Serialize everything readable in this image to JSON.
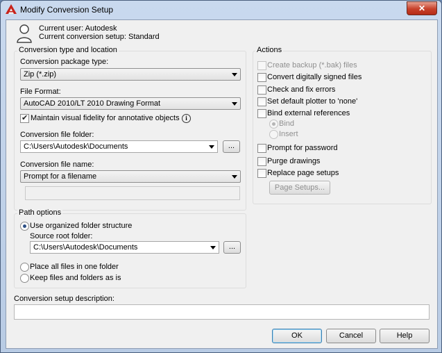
{
  "window": {
    "title": "Modify Conversion Setup",
    "close_glyph": "✕"
  },
  "header": {
    "current_user": "Current user: Autodesk",
    "current_setup": "Current conversion setup: Standard"
  },
  "conversion": {
    "group_title": "Conversion type and location",
    "package_label": "Conversion package type:",
    "package_value": "Zip (*.zip)",
    "format_label": "File Format:",
    "format_value": "AutoCAD 2010/LT 2010 Drawing Format",
    "fidelity_label": "Maintain visual fidelity for annotative objects",
    "fidelity_checked": true,
    "info_glyph": "i",
    "folder_label": "Conversion file folder:",
    "folder_value": "C:\\Users\\Autodesk\\Documents",
    "browse_label": "...",
    "name_label": "Conversion file name:",
    "name_value": "Prompt for a filename",
    "name_text": ""
  },
  "path": {
    "group_title": "Path options",
    "organized_label": "Use organized folder structure",
    "source_root_label": "Source root folder:",
    "source_root_value": "C:\\Users\\Autodesk\\Documents",
    "browse_label": "...",
    "one_folder_label": "Place all files in one folder",
    "keep_label": "Keep files and folders as is",
    "selected": "organized"
  },
  "actions": {
    "group_title": "Actions",
    "items": [
      {
        "label": "Create backup (*.bak) files",
        "checked": false,
        "enabled": false
      },
      {
        "label": "Convert digitally signed files",
        "checked": false,
        "enabled": true
      },
      {
        "label": "Check and fix errors",
        "checked": false,
        "enabled": true
      },
      {
        "label": "Set default plotter to 'none'",
        "checked": false,
        "enabled": true
      },
      {
        "label": "Bind external references",
        "checked": false,
        "enabled": true
      },
      {
        "label": "Prompt for password",
        "checked": false,
        "enabled": true
      },
      {
        "label": "Purge drawings",
        "checked": false,
        "enabled": true
      },
      {
        "label": "Replace page setups",
        "checked": false,
        "enabled": true
      }
    ],
    "bind_option": "Bind",
    "insert_option": "Insert",
    "page_setups_button": "Page Setups..."
  },
  "description": {
    "label": "Conversion setup description:",
    "value": ""
  },
  "buttons": {
    "ok": "OK",
    "cancel": "Cancel",
    "help": "Help"
  }
}
